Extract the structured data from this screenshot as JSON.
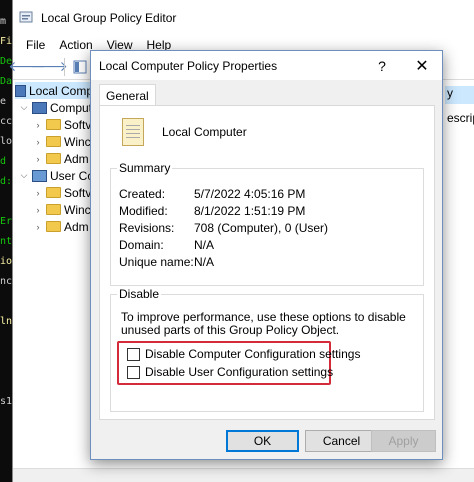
{
  "background_app": {
    "title": "Local Group Policy Editor",
    "menu": [
      "File",
      "Action",
      "View",
      "Help"
    ],
    "tree": {
      "root": "Local Comp",
      "computer": "Comput",
      "computer_children": [
        "Softv",
        "Winc",
        "Adm"
      ],
      "user": "User Co",
      "user_children": [
        "Softv",
        "Winc",
        "Adm"
      ]
    },
    "right_header": "y",
    "right_desc": "escript"
  },
  "terminal_fragments": [
    "m",
    "Fil",
    "De",
    "Da",
    "e B",
    "ccl",
    "lo",
    "d",
    "d:",
    "Er",
    "nt",
    "io",
    "nc",
    "ln",
    "s1"
  ],
  "dialog": {
    "title": "Local Computer Policy Properties",
    "help": "?",
    "close": "✕",
    "tab": "General",
    "object_name": "Local Computer",
    "summary": {
      "label": "Summary",
      "rows": [
        {
          "key": "Created:",
          "value": "5/7/2022 4:05:16 PM"
        },
        {
          "key": "Modified:",
          "value": "8/1/2022 1:51:19 PM"
        },
        {
          "key": "Revisions:",
          "value": "708 (Computer), 0 (User)"
        },
        {
          "key": "Domain:",
          "value": "N/A"
        },
        {
          "key": "Unique name:",
          "value": "N/A"
        }
      ]
    },
    "disable": {
      "label": "Disable",
      "description": "To improve performance, use these options to disable unused parts of this Group Policy Object.",
      "options": [
        {
          "label": "Disable Computer Configuration settings",
          "checked": false
        },
        {
          "label": "Disable User Configuration settings",
          "checked": false
        }
      ],
      "highlight_color": "#d42a3a"
    },
    "buttons": {
      "ok": "OK",
      "cancel": "Cancel",
      "apply": "Apply"
    }
  },
  "colors": {
    "accent": "#0078d7",
    "selection": "#cce8ff"
  }
}
